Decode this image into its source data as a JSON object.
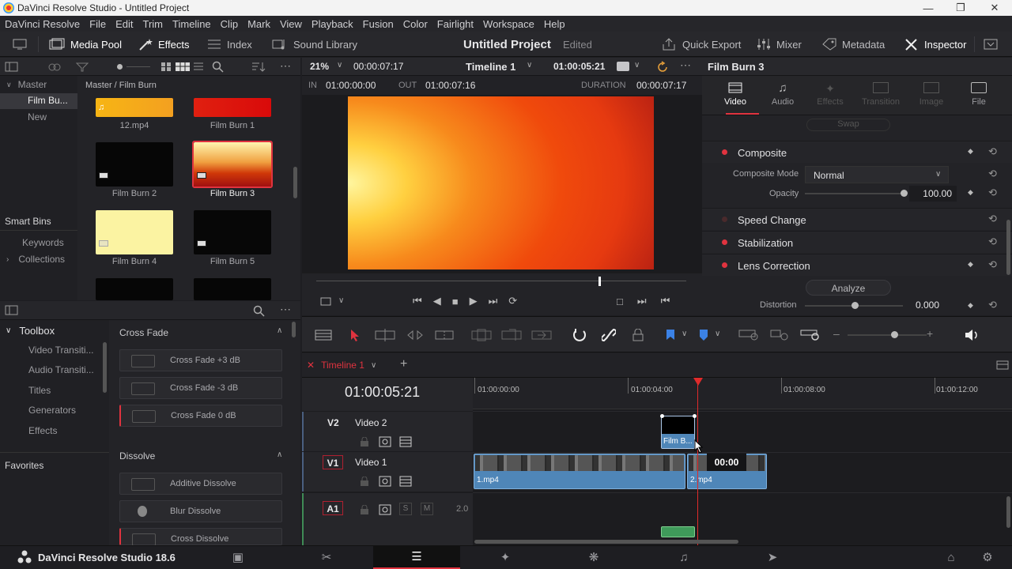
{
  "titlebar": {
    "title": "DaVinci Resolve Studio - Untitled Project"
  },
  "menu": [
    "DaVinci Resolve",
    "File",
    "Edit",
    "Trim",
    "Timeline",
    "Clip",
    "Mark",
    "View",
    "Playback",
    "Fusion",
    "Color",
    "Fairlight",
    "Workspace",
    "Help"
  ],
  "toolbar": {
    "media_pool": "Media Pool",
    "effects": "Effects",
    "index": "Index",
    "sound_library": "Sound Library",
    "project_title": "Untitled Project",
    "edited": "Edited",
    "quick_export": "Quick Export",
    "mixer": "Mixer",
    "metadata": "Metadata",
    "inspector": "Inspector"
  },
  "bins": {
    "master": "Master",
    "film_burn": "Film Bu...",
    "new": "New",
    "smart_bins": "Smart Bins",
    "keywords": "Keywords",
    "collections": "Collections"
  },
  "media": {
    "path": "Master / Film Burn",
    "items": [
      "12.mp4",
      "Film Burn 1",
      "Film Burn 2",
      "Film Burn 3",
      "Film Burn 4",
      "Film Burn 5"
    ]
  },
  "viewer": {
    "zoom": "21%",
    "tc_left": "00:00:07:17",
    "timeline_name": "Timeline 1",
    "tc_right": "01:00:05:21",
    "in_label": "IN",
    "in_tc": "01:00:00:00",
    "out_label": "OUT",
    "out_tc": "01:00:07:16",
    "duration_label": "DURATION",
    "duration_tc": "00:00:07:17"
  },
  "inspector": {
    "clip_name": "Film Burn 3",
    "tabs": [
      "Video",
      "Audio",
      "Effects",
      "Transition",
      "Image",
      "File"
    ],
    "swap": "Swap",
    "composite": "Composite",
    "composite_mode_label": "Composite Mode",
    "composite_mode_value": "Normal",
    "opacity_label": "Opacity",
    "opacity_value": "100.00",
    "speed_change": "Speed Change",
    "stabilization": "Stabilization",
    "lens_correction": "Lens Correction",
    "analyze": "Analyze",
    "distortion_label": "Distortion",
    "distortion_value": "0.000"
  },
  "toolbox": {
    "toolbox": "Toolbox",
    "items": [
      "Video Transiti...",
      "Audio Transiti...",
      "Titles",
      "Generators",
      "Effects"
    ],
    "favorites": "Favorites",
    "cross_fade": "Cross Fade",
    "cross_fade_items": [
      "Cross Fade +3 dB",
      "Cross Fade -3 dB",
      "Cross Fade 0 dB"
    ],
    "dissolve": "Dissolve",
    "dissolve_items": [
      "Additive Dissolve",
      "Blur Dissolve",
      "Cross Dissolve"
    ]
  },
  "timeline": {
    "tab": "Timeline 1",
    "timecode": "01:00:05:21",
    "ruler": [
      "01:00:00:00",
      "01:00:04:00",
      "01:00:08:00",
      "01:00:12:00"
    ],
    "tracks": {
      "v2_id": "V2",
      "v2_name": "Video 2",
      "v1_id": "V1",
      "v1_name": "Video 1",
      "a1_id": "A1",
      "a1_level": "2.0",
      "solo": "S",
      "mute": "M"
    },
    "clips": {
      "film_burn": "Film B...",
      "clip1": "1.mp4",
      "clip2": "2.mp4",
      "trim_tooltip": "00:00"
    }
  },
  "statusbar": {
    "app_version": "DaVinci Resolve Studio 18.6"
  },
  "colors": {
    "accent_red": "#e0333f",
    "clip_blue": "#4f86b8",
    "playhead": "#e02b2b"
  }
}
